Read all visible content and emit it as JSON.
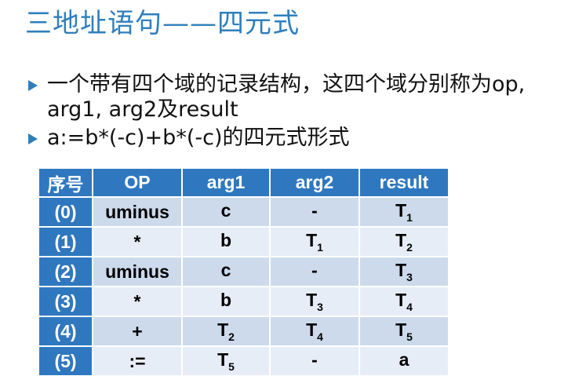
{
  "title": "三地址语句——四元式",
  "bullets": [
    "一个带有四个域的记录结构，这四个域分别称为op, arg1, arg2及result",
    "a:=b*(-c)+b*(-c)的四元式形式"
  ],
  "table": {
    "headers": [
      "序号",
      "OP",
      "arg1",
      "arg2",
      "result"
    ],
    "rows": [
      {
        "idx": "(0)",
        "op": "uminus",
        "arg1": "c",
        "arg1_sub": "",
        "arg2": "-",
        "arg2_sub": "",
        "result": "T",
        "result_sub": "1"
      },
      {
        "idx": "(1)",
        "op": "*",
        "arg1": "b",
        "arg1_sub": "",
        "arg2": "T",
        "arg2_sub": "1",
        "result": "T",
        "result_sub": "2"
      },
      {
        "idx": "(2)",
        "op": "uminus",
        "arg1": "c",
        "arg1_sub": "",
        "arg2": "-",
        "arg2_sub": "",
        "result": "T",
        "result_sub": "3"
      },
      {
        "idx": "(3)",
        "op": "*",
        "arg1": "b",
        "arg1_sub": "",
        "arg2": "T",
        "arg2_sub": "3",
        "result": "T",
        "result_sub": "4"
      },
      {
        "idx": "(4)",
        "op": "+",
        "arg1": "T",
        "arg1_sub": "2",
        "arg2": "T",
        "arg2_sub": "4",
        "result": "T",
        "result_sub": "5"
      },
      {
        "idx": "(5)",
        "op": ":=",
        "arg1": "T",
        "arg1_sub": "5",
        "arg2": "-",
        "arg2_sub": "",
        "result": "a",
        "result_sub": ""
      }
    ]
  },
  "colors": {
    "accent": "#2e7fbd",
    "header_bg": "#2f78c0",
    "row_odd": "#ccdaeb",
    "row_even": "#e7edf6"
  }
}
